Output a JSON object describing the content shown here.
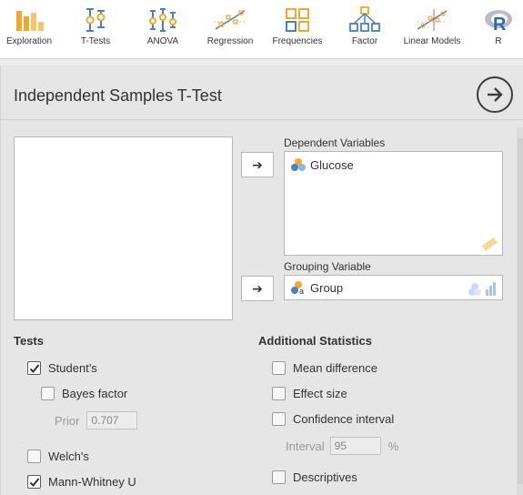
{
  "toolbar": {
    "items": [
      {
        "label": "Exploration",
        "icon": "bar-chart-icon"
      },
      {
        "label": "T-Tests",
        "icon": "t-tests-icon"
      },
      {
        "label": "ANOVA",
        "icon": "anova-icon"
      },
      {
        "label": "Regression",
        "icon": "regression-icon"
      },
      {
        "label": "Frequencies",
        "icon": "frequencies-icon"
      },
      {
        "label": "Factor",
        "icon": "factor-icon"
      },
      {
        "label": "Linear Models",
        "icon": "linear-models-icon"
      },
      {
        "label": "R",
        "icon": "r-icon"
      }
    ],
    "accent": "#f0a830",
    "blue": "#4a7fc0"
  },
  "panel": {
    "title": "Independent Samples T-Test"
  },
  "dependent": {
    "label": "Dependent Variables",
    "variables": [
      "Glucose"
    ]
  },
  "grouping": {
    "label": "Grouping Variable",
    "variable": "Group"
  },
  "tests": {
    "heading": "Tests",
    "students": {
      "label": "Student's",
      "checked": true
    },
    "bayes": {
      "label": "Bayes factor",
      "checked": false
    },
    "prior": {
      "label": "Prior",
      "value": "0.707"
    },
    "welchs": {
      "label": "Welch's",
      "checked": false
    },
    "mann_whitney": {
      "label": "Mann-Whitney U",
      "checked": true
    }
  },
  "additional": {
    "heading": "Additional Statistics",
    "mean_difference": {
      "label": "Mean difference",
      "checked": false
    },
    "effect_size": {
      "label": "Effect size",
      "checked": false
    },
    "confidence_interval": {
      "label": "Confidence interval",
      "checked": false
    },
    "interval": {
      "label": "Interval",
      "value": "95",
      "unit": "%"
    },
    "descriptives": {
      "label": "Descriptives",
      "checked": false
    }
  }
}
